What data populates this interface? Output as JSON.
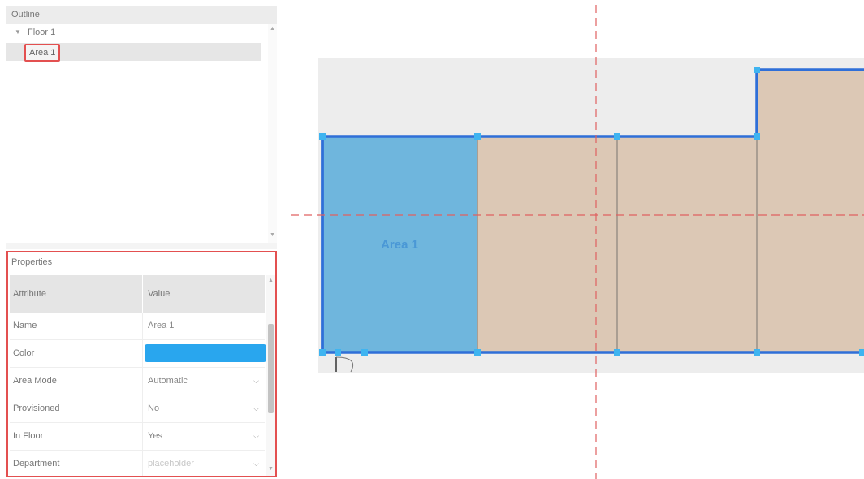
{
  "outline": {
    "title": "Outline",
    "floor_label": "Floor 1",
    "area_label": "Area 1",
    "caret_glyph": "▼"
  },
  "properties": {
    "title": "Properties",
    "col_attribute": "Attribute",
    "col_value": "Value",
    "rows": [
      {
        "label": "Name",
        "value": "Area 1"
      },
      {
        "label": "Color",
        "value": "",
        "color": "#29a6ee"
      },
      {
        "label": "Area Mode",
        "value": "Automatic"
      },
      {
        "label": "Provisioned",
        "value": "No"
      },
      {
        "label": "In Floor",
        "value": "Yes"
      },
      {
        "label": "Department",
        "value": "placeholder"
      }
    ]
  },
  "canvas": {
    "area_label": "Area 1",
    "colors": {
      "selected_fill": "#6fb6dd",
      "room_fill": "#dcc8b5",
      "outline": "#2f6fd8",
      "guide": "#e06060",
      "handle": "#3fb4f0"
    }
  },
  "icons": {
    "collapse": "collapse-left-icon",
    "chevron": "chevron-down-icon"
  }
}
